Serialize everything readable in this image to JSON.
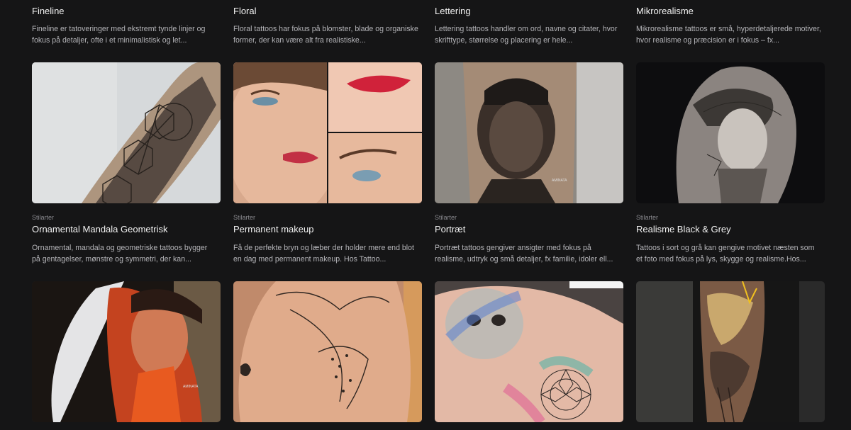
{
  "cards": [
    {
      "category": "",
      "title": "Fineline",
      "description": "Fineline er tatoveringer med ekstremt tynde linjer og fokus på detaljer, ofte i et minimalistisk og let..."
    },
    {
      "category": "",
      "title": "Floral",
      "description": "Floral tattoos har fokus på blomster, blade og organiske former, der kan være alt fra realistiske..."
    },
    {
      "category": "",
      "title": "Lettering",
      "description": "Lettering tattoos handler om ord, navne og citater, hvor skrifttype, størrelse og placering er hele..."
    },
    {
      "category": "",
      "title": "Mikrorealisme",
      "description": "Mikrorealisme tattoos er små, hyperdetaljerede motiver, hvor realisme og præcision er i fokus – fx..."
    },
    {
      "category": "Stilarter",
      "title": "Ornamental Mandala Geometrisk",
      "description": "Ornamental, mandala og geometriske tattoos bygger på gentagelser, mønstre og symmetri, der kan..."
    },
    {
      "category": "Stilarter",
      "title": "Permanent makeup",
      "description": "Få de perfekte bryn og læber der holder mere end blot en dag med permanent makeup. Hos Tattoo..."
    },
    {
      "category": "Stilarter",
      "title": "Portræt",
      "description": "Portræt tattoos gengiver ansigter med fokus på realisme, udtryk og små detaljer, fx familie, idoler ell..."
    },
    {
      "category": "Stilarter",
      "title": "Realisme Black & Grey",
      "description": "Tattoos i sort og grå kan gengive motivet næsten som et foto med fokus på lys, skygge og realisme.Hos..."
    }
  ],
  "images": [
    {
      "icon": "geometric-sleeve-photo"
    },
    {
      "icon": "permanent-makeup-photo"
    },
    {
      "icon": "portrait-tattoo-photo"
    },
    {
      "icon": "statue-realism-tattoo-photo"
    },
    {
      "icon": "woman-face-color-tattoo-photo"
    },
    {
      "icon": "dragon-leopard-back-tattoo-photo"
    },
    {
      "icon": "pug-mandala-tattoo-photo"
    },
    {
      "icon": "color-sleeve-tattoo-photo"
    }
  ],
  "colors": {
    "background": "#151516",
    "title": "#f2f2f2",
    "description": "#b4b4b8",
    "category": "#8a8a8f"
  }
}
